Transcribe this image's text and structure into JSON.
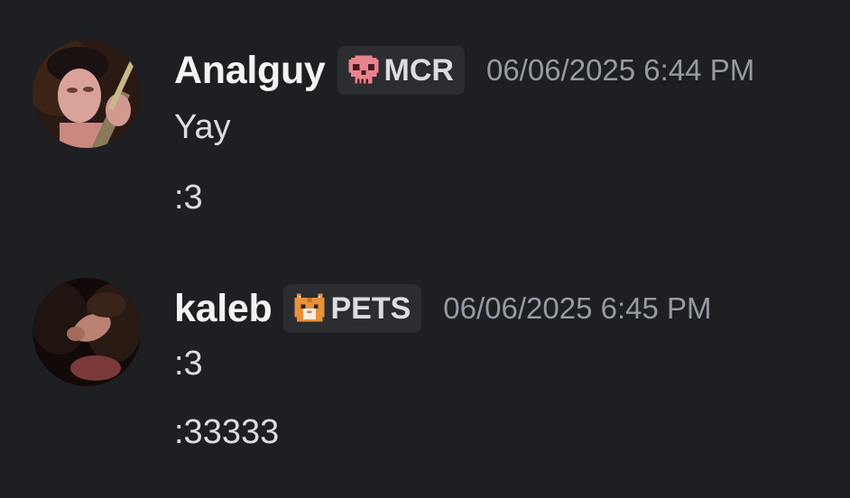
{
  "messages": [
    {
      "author": "Analguy",
      "tag_label": "MCR",
      "tag_icon": "skull-icon",
      "timestamp": "06/06/2025 6:44 PM",
      "lines": [
        "Yay",
        ":3"
      ]
    },
    {
      "author": "kaleb",
      "tag_label": "PETS",
      "tag_icon": "cat-icon",
      "timestamp": "06/06/2025 6:45 PM",
      "lines": [
        ":3",
        ":33333"
      ]
    }
  ],
  "colors": {
    "background": "#1e1f22",
    "username": "#f2f3f5",
    "message_text": "#dbdee1",
    "timestamp": "#949ba4",
    "tag_background": "#2b2d31",
    "skull_pink": "#e8838f",
    "cat_orange": "#e8923a"
  }
}
